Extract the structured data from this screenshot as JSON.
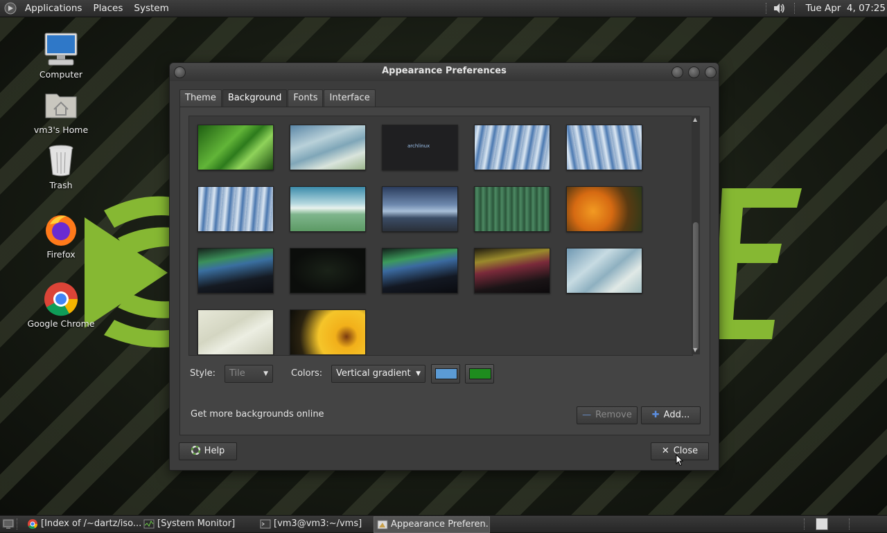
{
  "top_panel": {
    "menus": [
      "Applications",
      "Places",
      "System"
    ],
    "clock": "Tue Apr  4, 07:25"
  },
  "desktop_icons": [
    {
      "label": "Computer",
      "icon": "computer-icon"
    },
    {
      "label": "vm3's Home",
      "icon": "home-folder-icon"
    },
    {
      "label": "Trash",
      "icon": "trash-icon"
    },
    {
      "label": "Firefox",
      "icon": "firefox-icon"
    },
    {
      "label": "Google Chrome",
      "icon": "chrome-icon"
    }
  ],
  "dialog": {
    "title": "Appearance Preferences",
    "tabs": [
      "Theme",
      "Background",
      "Fonts",
      "Interface"
    ],
    "active_tab": "Background",
    "thumbnails": [
      "green-leaf",
      "blue-waves",
      "arch-dark",
      "blue-abstract",
      "blue-abstract-2",
      "blue-abstract-3",
      "green-hills",
      "stormy-sea",
      "green-stripes",
      "orange-flower",
      "aurora-green",
      "dark-black",
      "aurora-green-2",
      "aurora-yellow",
      "blue-waves-2",
      "white-sand",
      "yellow-flower"
    ],
    "thumb_arch_text": "archlinux",
    "style_label": "Style:",
    "style_value": "Tile",
    "colors_label": "Colors:",
    "colors_value": "Vertical gradient",
    "primary_color": "#5b9bd5",
    "secondary_color": "#1e8c1e",
    "get_more_link": "Get more backgrounds online",
    "remove_label": "Remove",
    "add_label": "Add...",
    "help_label": "Help",
    "close_label": "Close"
  },
  "taskbar": {
    "tasks": [
      {
        "label": "[Index of /~dartz/iso...",
        "icon": "chrome-icon"
      },
      {
        "label": "[System Monitor]",
        "icon": "system-monitor-icon"
      },
      {
        "label": "[vm3@vm3:~/vms]",
        "icon": "terminal-icon"
      },
      {
        "label": "Appearance Preferen...",
        "icon": "appearance-icon"
      }
    ]
  }
}
